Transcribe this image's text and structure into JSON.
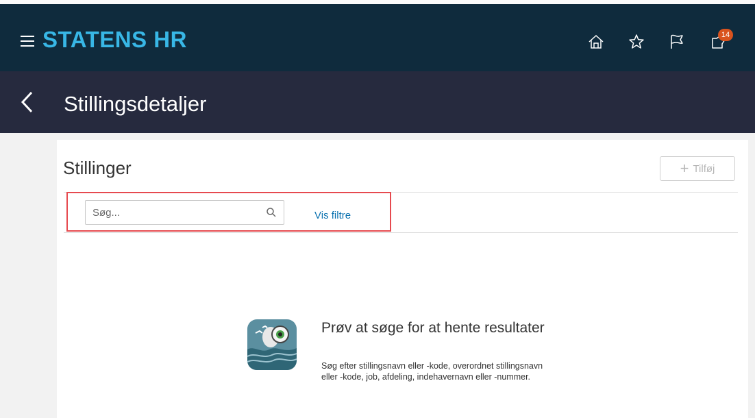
{
  "app": {
    "brand": "STATENS HR",
    "notification_count": "14"
  },
  "page": {
    "title": "Stillingsdetaljer"
  },
  "section": {
    "title": "Stillinger",
    "add_label": "Tilføj"
  },
  "search": {
    "placeholder": "Søg...",
    "value": "",
    "filters_link": "Vis filtre"
  },
  "empty_state": {
    "title": "Prøv at søge for at hente resultater",
    "description": "Søg efter stillingsnavn eller -kode, overordnet stillingsnavn eller -kode, job, afdeling, indehavernavn eller -nummer."
  },
  "icons": {
    "menu": "hamburger-icon",
    "home": "home-icon",
    "favorites": "star-icon",
    "flag": "flag-icon",
    "notifications": "bell-icon",
    "back": "chevron-left-icon",
    "search": "magnifier-icon",
    "add": "plus-icon"
  },
  "colors": {
    "topbar": "#0f2b3d",
    "subbar": "#262a3e",
    "brand": "#38b7e6",
    "link": "#0b72b0",
    "badge": "#d9531e",
    "highlight": "#e64a4f"
  }
}
